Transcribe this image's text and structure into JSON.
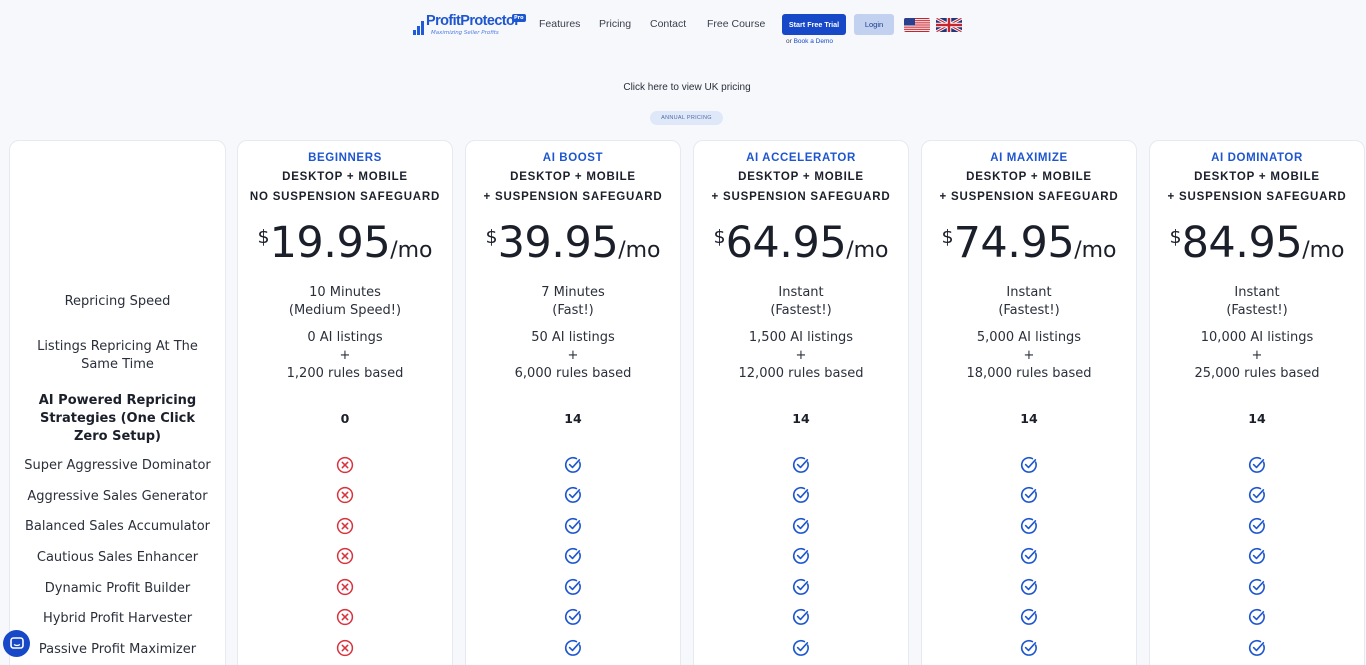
{
  "brand": {
    "name": "ProfitProtector",
    "tagline": "Maximizing Seller Profits",
    "badge": "Pro"
  },
  "nav": {
    "items": [
      "Features",
      "Pricing",
      "Contact",
      "Free Course"
    ],
    "trial_label": "Start Free Trial",
    "demo_prefix": "or",
    "demo_link": "Book a Demo",
    "login_label": "Login"
  },
  "uk_pricing_link": "Click here to view UK pricing",
  "billing_badge": "ANNUAL PRICING",
  "row_labels": {
    "speed": "Repricing Speed",
    "listings": "Listings Repricing At The Same Time",
    "strategies": "AI Powered Repricing Strategies (One Click Zero Setup)",
    "features": [
      "Super Aggressive Dominator",
      "Aggressive Sales Generator",
      "Balanced Sales Accumulator",
      "Cautious Sales Enhancer",
      "Dynamic Profit Builder",
      "Hybrid Profit Harvester",
      "Passive Profit Maximizer"
    ]
  },
  "plans": [
    {
      "name": "BEGINNERS",
      "line1": "DESKTOP + MOBILE",
      "line2": "NO SUSPENSION SAFEGUARD",
      "currency": "$",
      "price": "19.95",
      "period": "/mo",
      "speed": "10 Minutes",
      "speed_note": "(Medium Speed!)",
      "ai_listings": "0 AI listings",
      "plus": "+",
      "rules_listings": "1,200 rules based",
      "strategies": "0",
      "features_included": false
    },
    {
      "name": "AI BOOST",
      "line1": "DESKTOP + MOBILE",
      "line2": "+ SUSPENSION SAFEGUARD",
      "currency": "$",
      "price": "39.95",
      "period": "/mo",
      "speed": "7 Minutes",
      "speed_note": "(Fast!)",
      "ai_listings": "50 AI listings",
      "plus": "+",
      "rules_listings": "6,000 rules based",
      "strategies": "14",
      "features_included": true
    },
    {
      "name": "AI ACCELERATOR",
      "line1": "DESKTOP + MOBILE",
      "line2": "+ SUSPENSION SAFEGUARD",
      "currency": "$",
      "price": "64.95",
      "period": "/mo",
      "speed": "Instant",
      "speed_note": "(Fastest!)",
      "ai_listings": "1,500 AI listings",
      "plus": "+",
      "rules_listings": "12,000 rules based",
      "strategies": "14",
      "features_included": true
    },
    {
      "name": "AI MAXIMIZE",
      "line1": "DESKTOP + MOBILE",
      "line2": "+ SUSPENSION SAFEGUARD",
      "currency": "$",
      "price": "74.95",
      "period": "/mo",
      "speed": "Instant",
      "speed_note": "(Fastest!)",
      "ai_listings": "5,000 AI listings",
      "plus": "+",
      "rules_listings": "18,000 rules based",
      "strategies": "14",
      "features_included": true
    },
    {
      "name": "AI DOMINATOR",
      "line1": "DESKTOP + MOBILE",
      "line2": "+ SUSPENSION SAFEGUARD",
      "currency": "$",
      "price": "84.95",
      "period": "/mo",
      "speed": "Instant",
      "speed_note": "(Fastest!)",
      "ai_listings": "10,000 AI listings",
      "plus": "+",
      "rules_listings": "25,000 rules based",
      "strategies": "14",
      "features_included": true
    }
  ],
  "colors": {
    "accent": "#1e56cf",
    "check": "#1e56cf",
    "cross": "#d9323c",
    "background": "#f7f8fc"
  },
  "icons": {
    "included": "check-circle-icon",
    "excluded": "x-circle-icon",
    "chat": "chat-icon"
  }
}
